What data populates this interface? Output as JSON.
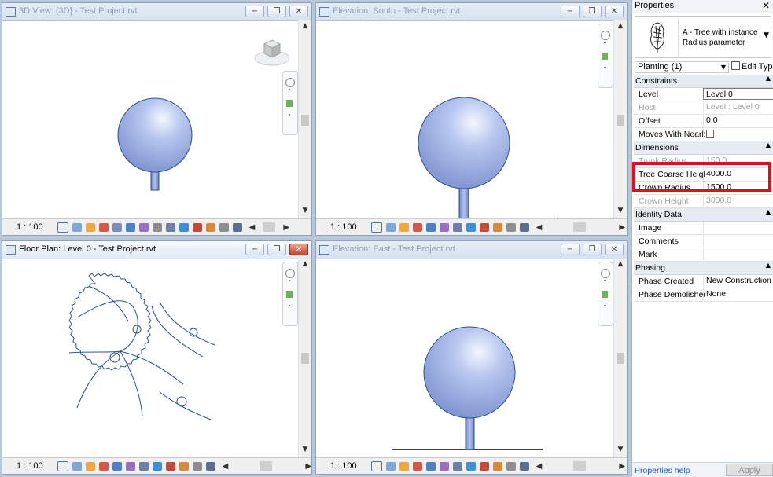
{
  "colors": {
    "selection_highlight": "#d9121b",
    "element_blue": "#9fb2e6",
    "line_blue": "#2b4f86"
  },
  "viewports": [
    {
      "title": "3D View: {3D} - Test Project.rvt",
      "scale": "1 : 100"
    },
    {
      "title": "Elevation: South - Test Project.rvt",
      "scale": "1 : 100"
    },
    {
      "title": "Floor Plan: Level 0 - Test Project.rvt",
      "scale": "1 : 100"
    },
    {
      "title": "Elevation: East - Test Project.rvt",
      "scale": "1 : 100"
    }
  ],
  "window_buttons": {
    "minimize": "−",
    "restore": "❒",
    "close": "✕"
  },
  "properties": {
    "title": "Properties",
    "close": "✕",
    "type_name": "A - Tree with instance Radius parameter",
    "instance_selector": "Planting (1)",
    "edit_type": "Edit Type",
    "groups": [
      {
        "name": "Constraints",
        "rows": [
          {
            "name": "Level",
            "value": "Level 0"
          },
          {
            "name": "Host",
            "value": "Level : Level 0"
          },
          {
            "name": "Offset",
            "value": "0.0"
          },
          {
            "name": "Moves With Nearby Elements",
            "value": ""
          }
        ]
      },
      {
        "name": "Dimensions",
        "rows": [
          {
            "name": "Trunk Radius",
            "value": "150.0"
          },
          {
            "name": "Tree Coarse Height",
            "value": "4000.0"
          },
          {
            "name": "Crown Radius",
            "value": "1500.0"
          },
          {
            "name": "Crown Height",
            "value": "3000.0"
          }
        ]
      },
      {
        "name": "Identity Data",
        "rows": [
          {
            "name": "Image",
            "value": ""
          },
          {
            "name": "Comments",
            "value": ""
          },
          {
            "name": "Mark",
            "value": ""
          }
        ]
      },
      {
        "name": "Phasing",
        "rows": [
          {
            "name": "Phase Created",
            "value": "New Construction"
          },
          {
            "name": "Phase Demolished",
            "value": "None"
          }
        ]
      }
    ],
    "help_link": "Properties help",
    "apply": "Apply"
  }
}
